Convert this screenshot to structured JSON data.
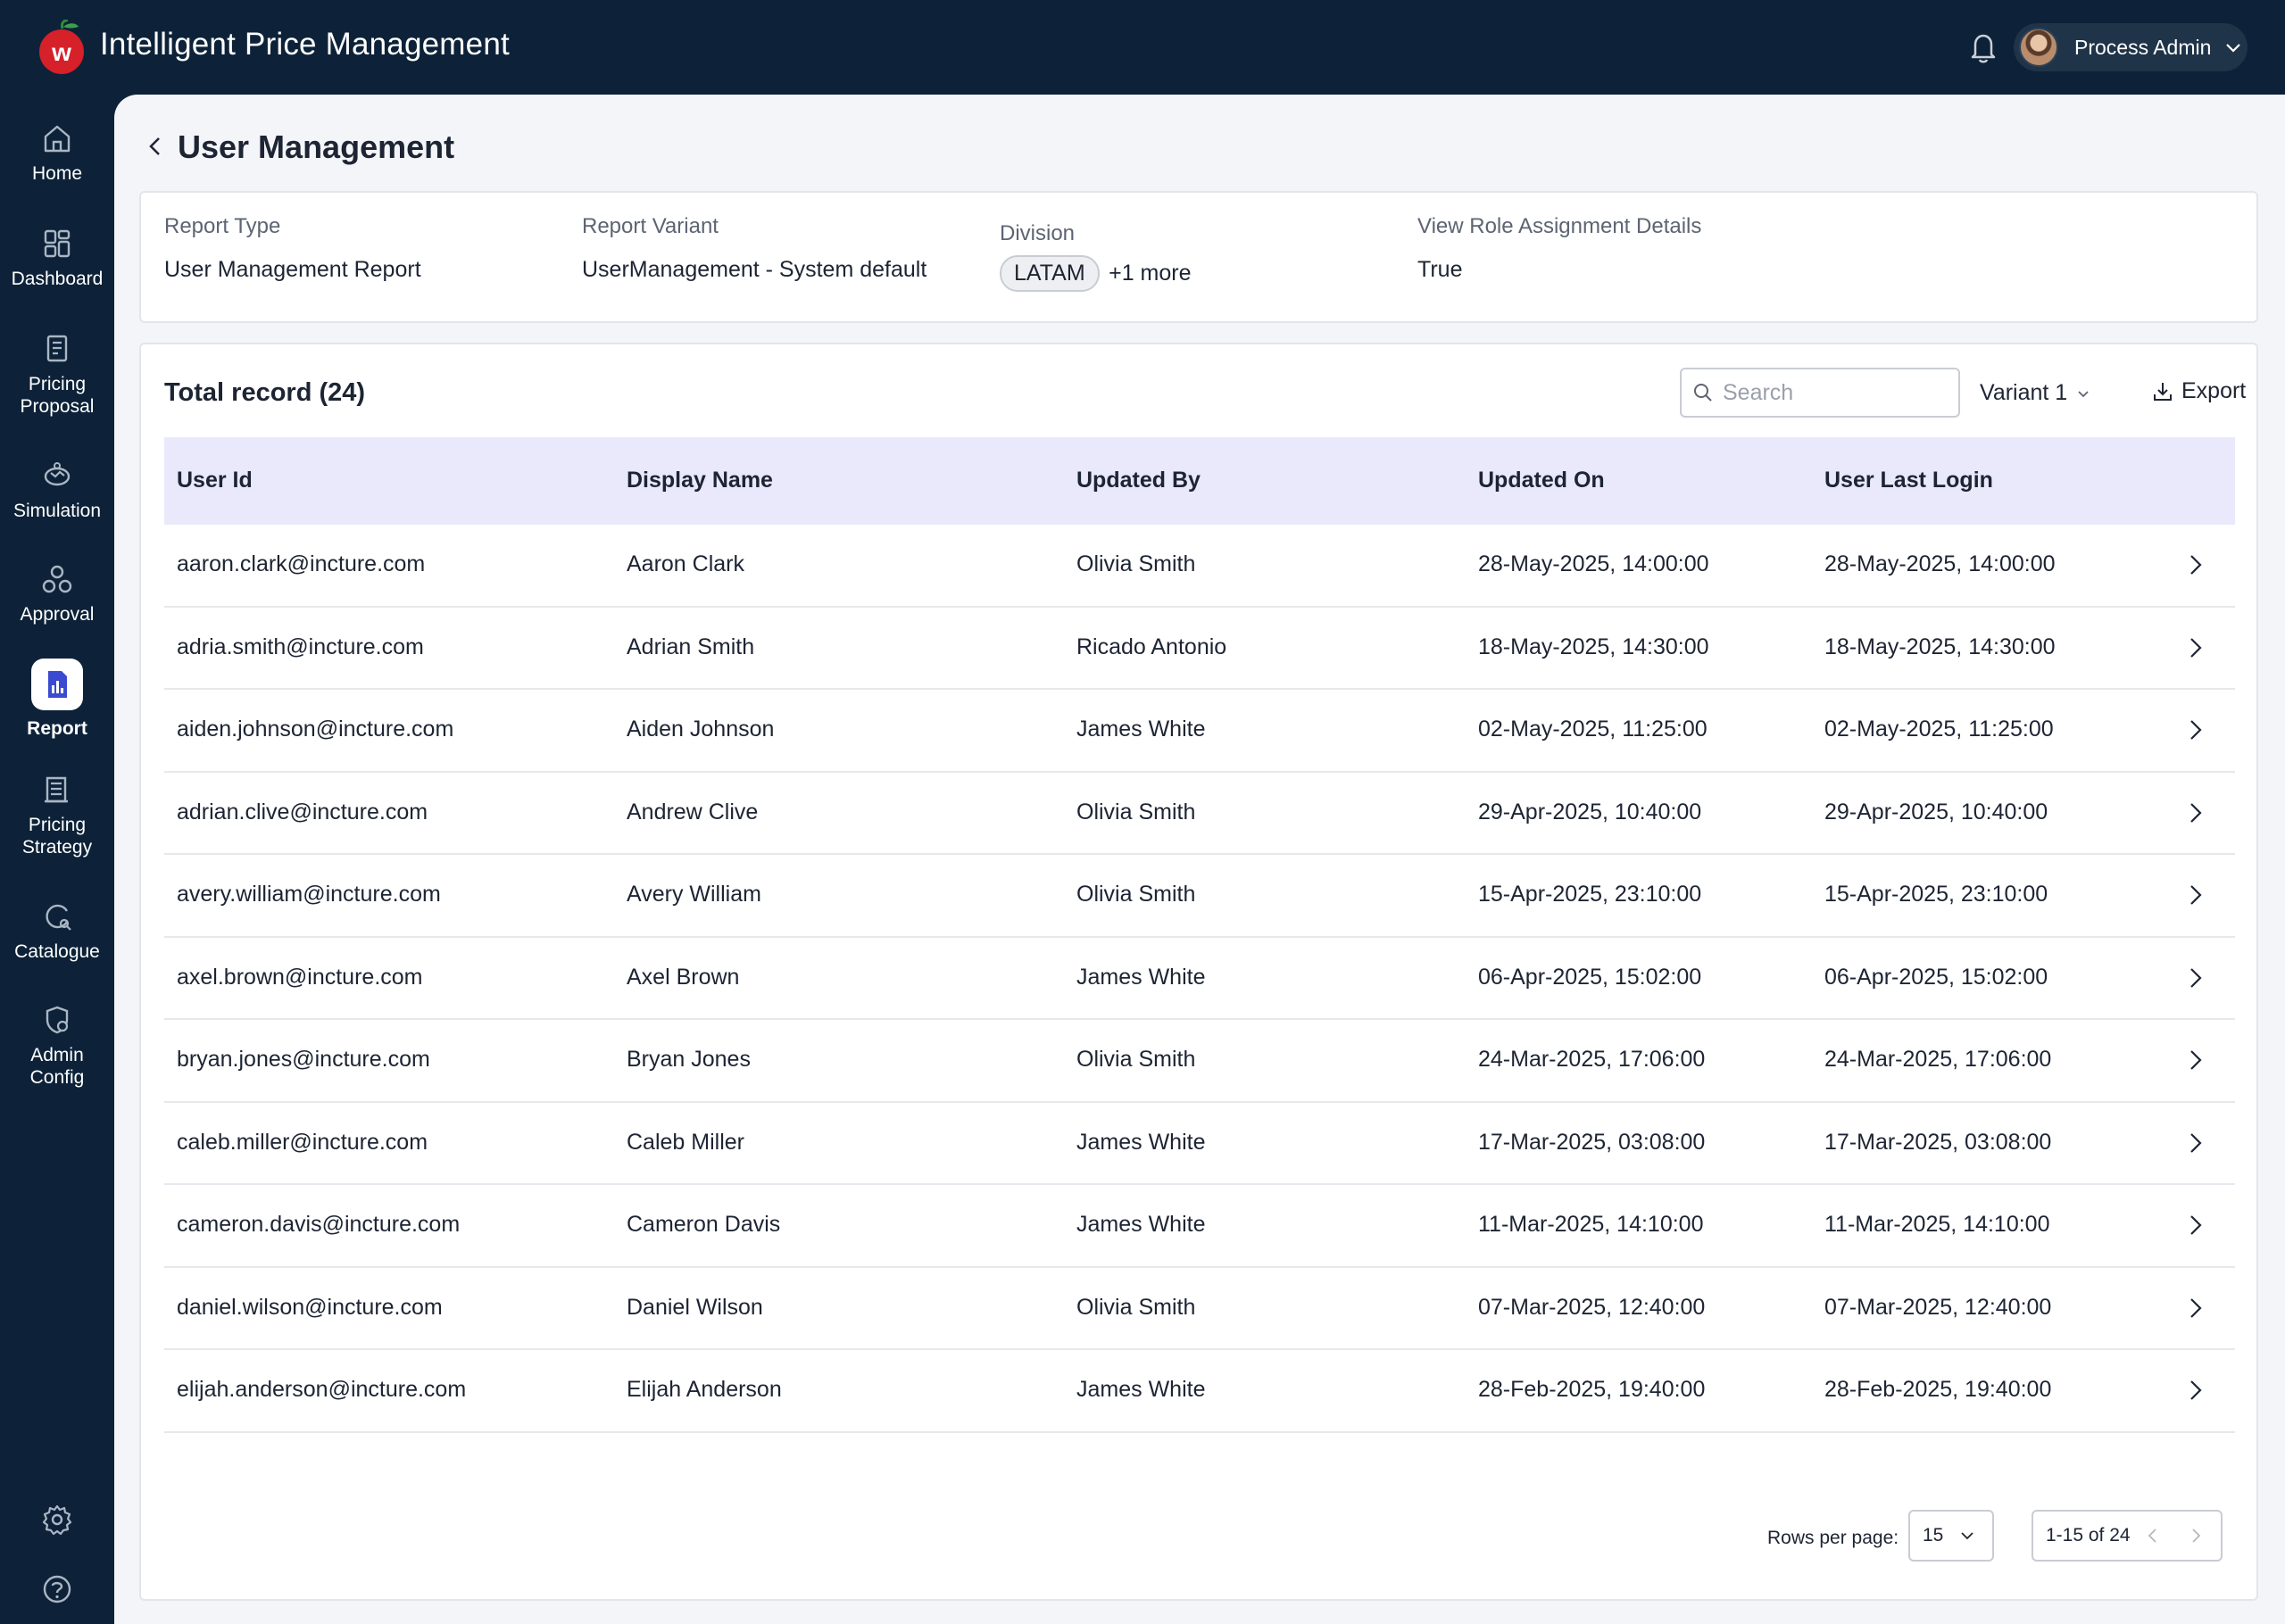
{
  "app": {
    "title": "Intelligent Price Management",
    "user_name": "Process Admin"
  },
  "colors": {
    "navy": "#0d2238",
    "header_row": "#e9e9fb",
    "active_icon": "#3b4bd1",
    "logo_red": "#d6202a"
  },
  "sidebar": {
    "items": [
      {
        "label1": "Home",
        "label2": "",
        "icon": "home-icon"
      },
      {
        "label1": "Dashboard",
        "label2": "",
        "icon": "dashboard-icon"
      },
      {
        "label1": "Pricing",
        "label2": "Proposal",
        "icon": "pricing-proposal-icon"
      },
      {
        "label1": "Simulation",
        "label2": "",
        "icon": "simulation-icon"
      },
      {
        "label1": "Approval",
        "label2": "",
        "icon": "approval-icon"
      },
      {
        "label1": "Report",
        "label2": "",
        "icon": "report-icon"
      },
      {
        "label1": "Pricing",
        "label2": "Strategy",
        "icon": "pricing-strategy-icon"
      },
      {
        "label1": "Catalogue",
        "label2": "",
        "icon": "catalogue-icon"
      },
      {
        "label1": "Admin",
        "label2": "Config",
        "icon": "admin-config-icon"
      }
    ],
    "active_index": 5
  },
  "page": {
    "title": "User Management"
  },
  "filters": {
    "report_type_label": "Report Type",
    "report_type_value": "User Management Report",
    "report_variant_label": "Report Variant",
    "report_variant_value": "UserManagement - System default",
    "division_label": "Division",
    "division_chip": "LATAM",
    "division_more": "+1 more",
    "role_label": "View Role Assignment Details",
    "role_value": "True"
  },
  "table": {
    "total_label": "Total record (24)",
    "search_placeholder": "Search",
    "variant_label": "Variant 1",
    "export_label": "Export",
    "columns": [
      "User Id",
      "Display Name",
      "Updated By",
      "Updated On",
      "User Last Login"
    ],
    "rows": [
      [
        "aaron.clark@incture.com",
        "Aaron Clark",
        "Olivia Smith",
        "28-May-2025, 14:00:00",
        "28-May-2025, 14:00:00"
      ],
      [
        "adria.smith@incture.com",
        "Adrian Smith",
        "Ricado Antonio",
        "18-May-2025, 14:30:00",
        "18-May-2025, 14:30:00"
      ],
      [
        "aiden.johnson@incture.com",
        "Aiden Johnson",
        "James White",
        "02-May-2025, 11:25:00",
        "02-May-2025, 11:25:00"
      ],
      [
        "adrian.clive@incture.com",
        "Andrew Clive",
        "Olivia Smith",
        "29-Apr-2025, 10:40:00",
        "29-Apr-2025, 10:40:00"
      ],
      [
        "avery.william@incture.com",
        "Avery William",
        "Olivia Smith",
        "15-Apr-2025, 23:10:00",
        "15-Apr-2025, 23:10:00"
      ],
      [
        "axel.brown@incture.com",
        "Axel Brown",
        "James White",
        "06-Apr-2025, 15:02:00",
        "06-Apr-2025, 15:02:00"
      ],
      [
        "bryan.jones@incture.com",
        "Bryan Jones",
        "Olivia Smith",
        "24-Mar-2025, 17:06:00",
        "24-Mar-2025, 17:06:00"
      ],
      [
        "caleb.miller@incture.com",
        "Caleb Miller",
        "James White",
        "17-Mar-2025, 03:08:00",
        "17-Mar-2025, 03:08:00"
      ],
      [
        "cameron.davis@incture.com",
        "Cameron Davis",
        "James White",
        "11-Mar-2025, 14:10:00",
        "11-Mar-2025, 14:10:00"
      ],
      [
        "daniel.wilson@incture.com",
        "Daniel Wilson",
        "Olivia Smith",
        "07-Mar-2025, 12:40:00",
        "07-Mar-2025, 12:40:00"
      ],
      [
        "elijah.anderson@incture.com",
        "Elijah Anderson",
        "James White",
        "28-Feb-2025, 19:40:00",
        "28-Feb-2025, 19:40:00"
      ]
    ]
  },
  "pagination": {
    "rows_per_page_label": "Rows per page:",
    "rows_per_page_value": "15",
    "range": "1-15 of 24"
  }
}
